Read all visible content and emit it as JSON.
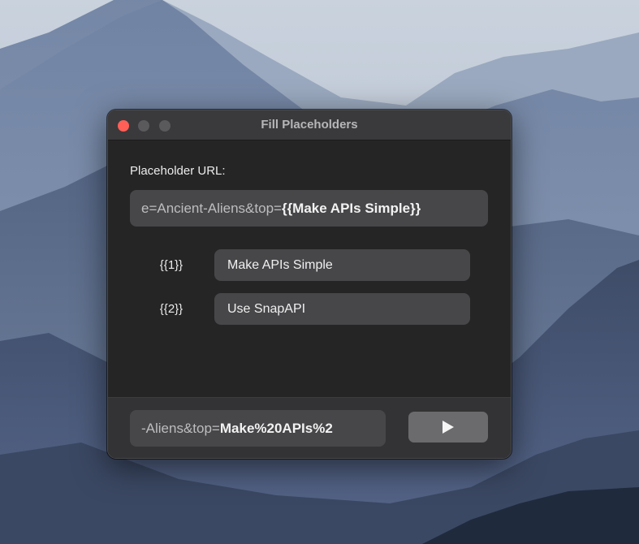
{
  "window": {
    "title": "Fill Placeholders"
  },
  "placeholder_url": {
    "label": "Placeholder URL:",
    "value_plain": "e=Ancient-Aliens&top=",
    "value_bold": "{{Make APIs Simple}}"
  },
  "placeholders": [
    {
      "token": "{{1}}",
      "value": "Make APIs Simple"
    },
    {
      "token": "{{2}}",
      "value": "Use SnapAPI"
    }
  ],
  "result": {
    "value_plain": "-Aliens&top=",
    "value_bold": "Make%20APIs%2"
  },
  "run_button": {
    "icon": "play-icon"
  },
  "colors": {
    "close": "#ff5f57",
    "window_bg": "#252526",
    "field_bg": "#47474a",
    "button_bg": "#6b6b6e"
  }
}
